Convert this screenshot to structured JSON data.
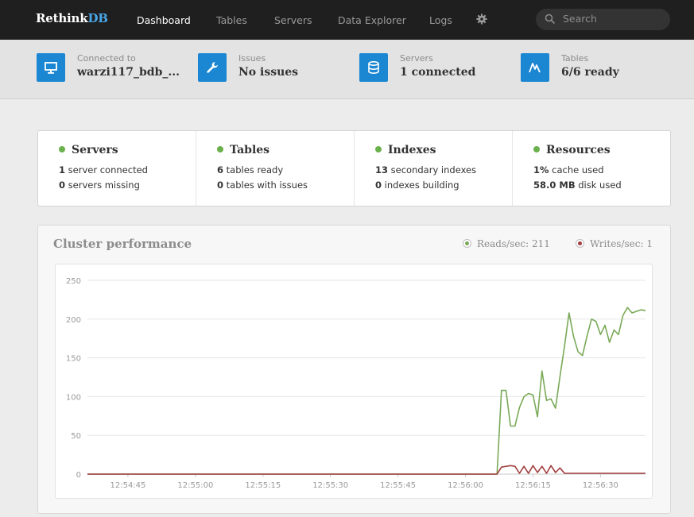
{
  "nav": {
    "brand_main": "Rethink",
    "brand_accent": "DB",
    "items": [
      {
        "label": "Dashboard",
        "active": true
      },
      {
        "label": "Tables",
        "active": false
      },
      {
        "label": "Servers",
        "active": false
      },
      {
        "label": "Data Explorer",
        "active": false
      },
      {
        "label": "Logs",
        "active": false
      }
    ],
    "settings_icon": "gear-icon",
    "search_placeholder": "Search"
  },
  "status": [
    {
      "label": "Connected to",
      "value": "warzi117_bdb_...",
      "icon": "monitor-icon"
    },
    {
      "label": "Issues",
      "value": "No issues",
      "icon": "wrench-icon"
    },
    {
      "label": "Servers",
      "value": "1 connected",
      "icon": "database-icon"
    },
    {
      "label": "Tables",
      "value": "6/6 ready",
      "icon": "activity-icon"
    }
  ],
  "summary": [
    {
      "title": "Servers",
      "lines": [
        {
          "bold": "1",
          "text": " server connected"
        },
        {
          "bold": "0",
          "text": " servers missing"
        }
      ]
    },
    {
      "title": "Tables",
      "lines": [
        {
          "bold": "6",
          "text": " tables ready"
        },
        {
          "bold": "0",
          "text": " tables with issues"
        }
      ]
    },
    {
      "title": "Indexes",
      "lines": [
        {
          "bold": "13",
          "text": " secondary indexes"
        },
        {
          "bold": "0",
          "text": " indexes building"
        }
      ]
    },
    {
      "title": "Resources",
      "lines": [
        {
          "bold": "1%",
          "text": " cache used"
        },
        {
          "bold": "58.0 MB",
          "text": " disk used"
        }
      ]
    }
  ],
  "performance": {
    "title": "Cluster performance",
    "reads_label": "Reads/sec: 211",
    "writes_label": "Writes/sec: 1",
    "reads_color": "#79a957",
    "writes_color": "#a23d3d"
  },
  "chart_data": {
    "type": "line",
    "ylim": [
      0,
      250
    ],
    "yticks": [
      0,
      50,
      100,
      150,
      200,
      250
    ],
    "xlim": [
      "12:54:36",
      "12:56:40"
    ],
    "xticks": [
      "12:54:45",
      "12:55:00",
      "12:55:15",
      "12:55:30",
      "12:55:45",
      "12:56:00",
      "12:56:15",
      "12:56:30"
    ],
    "grid": true,
    "series": [
      {
        "name": "Reads/sec",
        "x": [
          "12:54:36",
          "12:56:07",
          "12:56:08",
          "12:56:09",
          "12:56:10",
          "12:56:11",
          "12:56:12",
          "12:56:13",
          "12:56:14",
          "12:56:15",
          "12:56:16",
          "12:56:17",
          "12:56:18",
          "12:56:19",
          "12:56:20",
          "12:56:21",
          "12:56:22",
          "12:56:23",
          "12:56:24",
          "12:56:25",
          "12:56:26",
          "12:56:27",
          "12:56:28",
          "12:56:29",
          "12:56:30",
          "12:56:31",
          "12:56:32",
          "12:56:33",
          "12:56:34",
          "12:56:35",
          "12:56:36",
          "12:56:37",
          "12:56:38",
          "12:56:39",
          "12:56:40"
        ],
        "values": [
          0,
          0,
          108,
          108,
          62,
          62,
          86,
          100,
          104,
          102,
          74,
          133,
          95,
          97,
          85,
          126,
          165,
          208,
          178,
          158,
          153,
          178,
          200,
          197,
          180,
          192,
          170,
          186,
          180,
          205,
          215,
          208,
          210,
          212,
          211
        ]
      },
      {
        "name": "Writes/sec",
        "x": [
          "12:54:36",
          "12:56:07",
          "12:56:08",
          "12:56:09",
          "12:56:10",
          "12:56:11",
          "12:56:12",
          "12:56:13",
          "12:56:14",
          "12:56:15",
          "12:56:16",
          "12:56:17",
          "12:56:18",
          "12:56:19",
          "12:56:20",
          "12:56:21",
          "12:56:22",
          "12:56:23",
          "12:56:24",
          "12:56:25",
          "12:56:26",
          "12:56:40"
        ],
        "values": [
          0,
          0,
          9,
          10,
          11,
          10,
          1,
          10,
          1,
          11,
          2,
          10,
          1,
          11,
          2,
          8,
          1,
          1,
          1,
          1,
          1,
          1
        ]
      }
    ]
  }
}
